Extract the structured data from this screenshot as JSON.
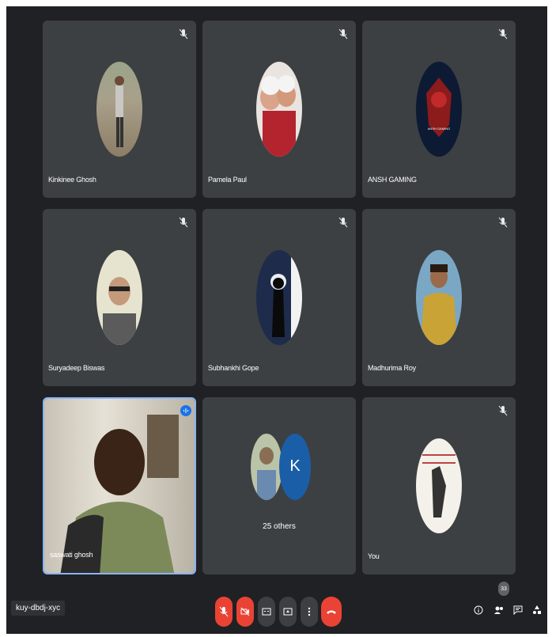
{
  "participants": [
    {
      "name": "Kinkinee Ghosh"
    },
    {
      "name": "Pamela Paul"
    },
    {
      "name": "ANSH GAMING",
      "avatar_text": "ANSH GAMING"
    },
    {
      "name": "Suryadeep Biswas"
    },
    {
      "name": "Subhankhi Gope"
    },
    {
      "name": "Madhurima Roy"
    },
    {
      "name": "saswati ghosh"
    },
    {
      "others_label": "25 others",
      "avatar_letter": "K"
    },
    {
      "name": "You"
    }
  ],
  "meeting": {
    "code": "kuy-dbdj-xyc",
    "participant_count": "33"
  },
  "colors": {
    "background": "#202124",
    "tile": "#3c4043",
    "red": "#ea4335",
    "speaking_border": "#8ab4f8",
    "k_avatar": "#1a5ea8"
  },
  "icons": {
    "tile_mute": "mic-off-icon",
    "controls": [
      "mic-off-icon",
      "camera-off-icon",
      "captions-icon",
      "present-icon",
      "more-options-icon",
      "end-call-icon"
    ],
    "right": [
      "info-icon",
      "people-icon",
      "chat-icon",
      "activities-icon"
    ]
  }
}
